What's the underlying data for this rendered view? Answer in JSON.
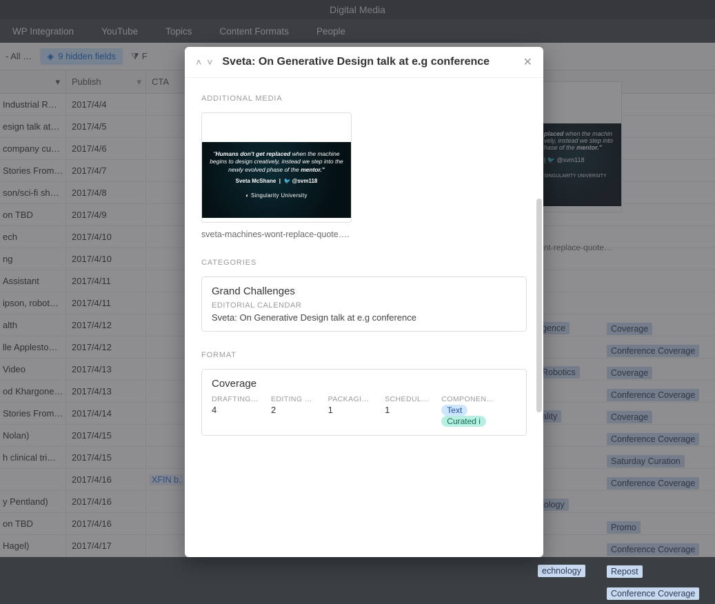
{
  "app_title": "Digital Media",
  "tabs": [
    "WP Integration",
    "YouTube",
    "Topics",
    "Content Formats",
    "People"
  ],
  "toolbar": {
    "view_label": " - All …",
    "hidden_fields": "9 hidden fields",
    "filter": "F"
  },
  "columns": {
    "a_caret": "▾",
    "b": "Publish",
    "b_caret": "▾",
    "c": "CTA"
  },
  "rows": [
    {
      "a": " Industrial R…",
      "b": "2017/4/4"
    },
    {
      "a": "esign talk at…",
      "b": "2017/4/5"
    },
    {
      "a": "company cu…",
      "b": "2017/4/6"
    },
    {
      "a": "Stories From…",
      "b": "2017/4/7"
    },
    {
      "a": "son/sci-fi sh…",
      "b": "2017/4/8"
    },
    {
      "a": "on TBD",
      "b": "2017/4/9"
    },
    {
      "a": "ech",
      "b": "2017/4/10"
    },
    {
      "a": "ng",
      "b": "2017/4/10"
    },
    {
      "a": "Assistant",
      "b": "2017/4/11"
    },
    {
      "a": "ipson, robot…",
      "b": "2017/4/11"
    },
    {
      "a": "alth",
      "b": "2017/4/12"
    },
    {
      "a": "lle Applesto…",
      "b": "2017/4/12"
    },
    {
      "a": "Video",
      "b": "2017/4/13"
    },
    {
      "a": "od Khargone…",
      "b": "2017/4/13"
    },
    {
      "a": "Stories From…",
      "b": "2017/4/14"
    },
    {
      "a": " Nolan)",
      "b": "2017/4/15"
    },
    {
      "a": "h clinical tri…",
      "b": "2017/4/15"
    },
    {
      "a": "",
      "b": "2017/4/16",
      "c": "XFIN b."
    },
    {
      "a": "y Pentland)",
      "b": "2017/4/16"
    },
    {
      "a": "on TBD",
      "b": "2017/4/16"
    },
    {
      "a": "Hagel)",
      "b": "2017/4/17"
    }
  ],
  "right_thumb_caption": "ont-replace-quote…",
  "right_tags_rows": [
    [],
    [],
    [
      "gence",
      "Coverage"
    ],
    [
      "",
      "Conference Coverage"
    ],
    [
      "Robotics",
      "Coverage"
    ],
    [
      "",
      "Conference Coverage"
    ],
    [
      "ality",
      "Coverage"
    ],
    [
      "",
      "Conference Coverage"
    ],
    [
      "",
      "Saturday Curation"
    ],
    [
      "",
      "Conference Coverage"
    ],
    [
      "iology",
      ""
    ],
    [
      "",
      "Promo"
    ],
    [
      "",
      "Conference Coverage"
    ],
    [
      "echnology",
      "Repost"
    ],
    [
      "",
      "Conference Coverage"
    ]
  ],
  "modal": {
    "title": "Sveta: On Generative Design talk at e.g conference",
    "additional_media_label": "ADDITIONAL MEDIA",
    "slide": {
      "quote_html": "\"Humans don't get replaced when the machine begins to design creatively, instead we step into the newly evolved phase of the mentor.\"",
      "author": "Sveta McShane",
      "twitter": "@svm118",
      "uni": "Singularity University"
    },
    "media_caption": "sveta-machines-wont-replace-quote….",
    "categories_label": "CATEGORIES",
    "category_card": {
      "title": "Grand Challenges",
      "sub": "EDITORIAL CALENDAR",
      "text": "Sveta: On Generative Design talk at e.g conference"
    },
    "format_label": "FORMAT",
    "format_card": {
      "title": "Coverage",
      "cols": [
        {
          "lbl": "DRAFTING …",
          "val": "4"
        },
        {
          "lbl": "EDITING D…",
          "val": "2"
        },
        {
          "lbl": "PACKAGIN…",
          "val": "1"
        },
        {
          "lbl": "SCHEDULI…",
          "val": "1"
        },
        {
          "lbl": "COMPONENTS",
          "val": ""
        }
      ],
      "pills": [
        "Text",
        "Curated i"
      ]
    }
  }
}
